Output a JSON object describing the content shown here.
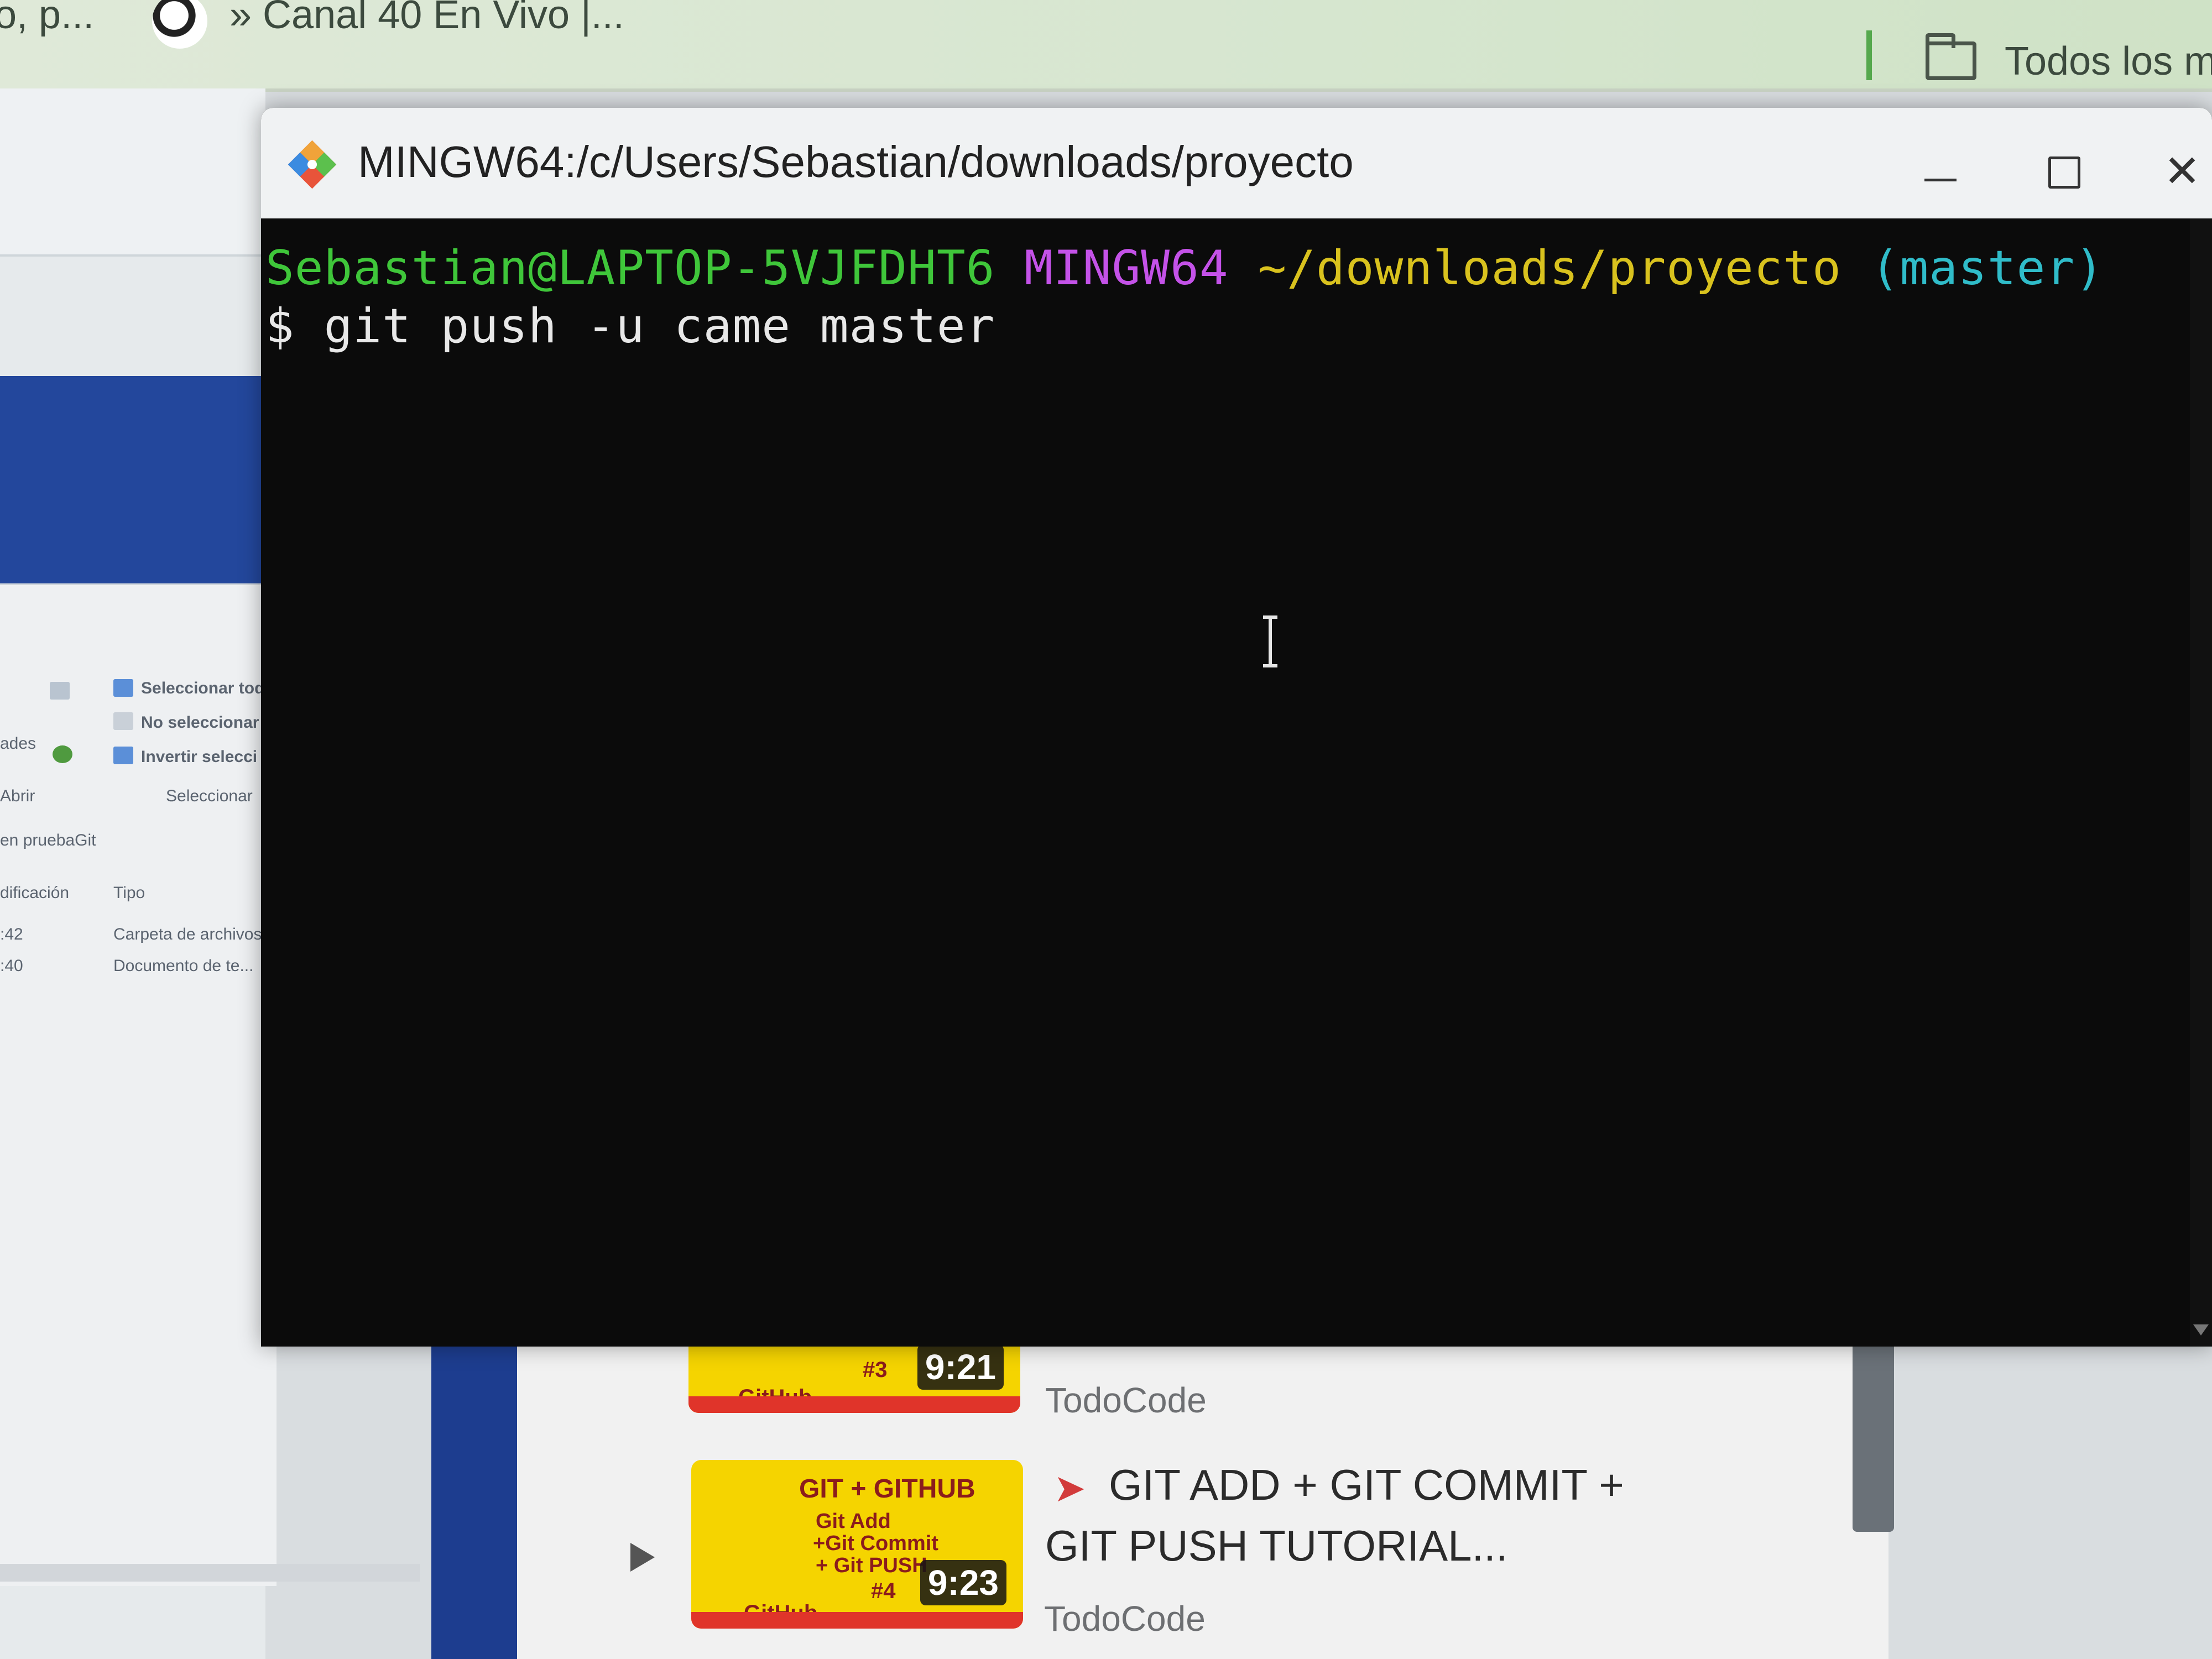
{
  "browser": {
    "bookmarks": {
      "left_truncated": "o, p...",
      "canal": "» Canal 40 En Vivo |...",
      "todos": "Todos los m"
    }
  },
  "explorer": {
    "select_all": "Seleccionar todo",
    "select_none": "No seleccionar n",
    "invert_selection": "Invertir selecci",
    "group_open": "Abrir",
    "group_select": "Seleccionar",
    "props_partial": "ades",
    "search_in": "en pruebaGit",
    "col_modified": "dificación",
    "col_type": "Tipo",
    "row1_time": ":42",
    "row1_type": "Carpeta de archivos",
    "row2_time": ":40",
    "row2_type": "Documento de te..."
  },
  "youtube": {
    "video1": {
      "thumb_brand": "GitHub",
      "thumb_num": "#3",
      "duration": "9:21",
      "channel": "TodoCode"
    },
    "video2": {
      "thumb_title": "GIT + GITHUB",
      "thumb_line1": "Git Add",
      "thumb_line2": "+Git Commit",
      "thumb_line3": "+ Git PUSH",
      "thumb_brand": "GitHub",
      "thumb_num": "#4",
      "duration": "9:23",
      "title_line1": "GIT ADD + GIT COMMIT +",
      "title_line2": "GIT PUSH TUTORIAL...",
      "channel": "TodoCode"
    }
  },
  "terminal": {
    "title": "MINGW64:/c/Users/Sebastian/downloads/proyecto",
    "prompt_user": "Sebastian@LAPTOP-5VJFDHT6",
    "prompt_system": "MINGW64",
    "prompt_path": "~/downloads/proyecto",
    "prompt_branch": "(master)",
    "prompt_symbol": "$",
    "command": "git push -u came master",
    "colors": {
      "user": "#3fc63a",
      "system": "#c452e8",
      "path": "#d9c21e",
      "branch": "#30bcc9",
      "background": "#0b0b0b"
    }
  },
  "icons": {
    "app": "git-bash-icon",
    "minimize": "minimize-icon",
    "maximize": "maximize-icon",
    "close": "close-icon",
    "cursor": "text-cursor-icon"
  }
}
